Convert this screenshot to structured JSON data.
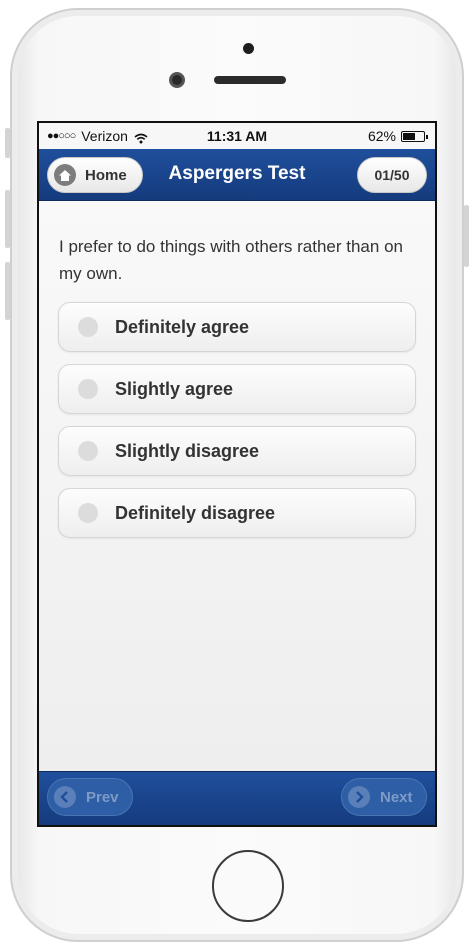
{
  "status_bar": {
    "signal_dots": "●●○○○",
    "carrier": "Verizon",
    "time": "11:31 AM",
    "battery_percent": "62%",
    "battery_level": 0.62
  },
  "header": {
    "home_label": "Home",
    "title": "Aspergers Test",
    "counter": "01/50"
  },
  "question": {
    "text": "I prefer to do things with others rather than on my own."
  },
  "options": [
    {
      "label": "Definitely agree"
    },
    {
      "label": "Slightly agree"
    },
    {
      "label": "Slightly disagree"
    },
    {
      "label": "Definitely disagree"
    }
  ],
  "footer": {
    "prev_label": "Prev",
    "next_label": "Next"
  },
  "colors": {
    "header_blue": "#1f4f9c",
    "text_dark": "#333333"
  }
}
